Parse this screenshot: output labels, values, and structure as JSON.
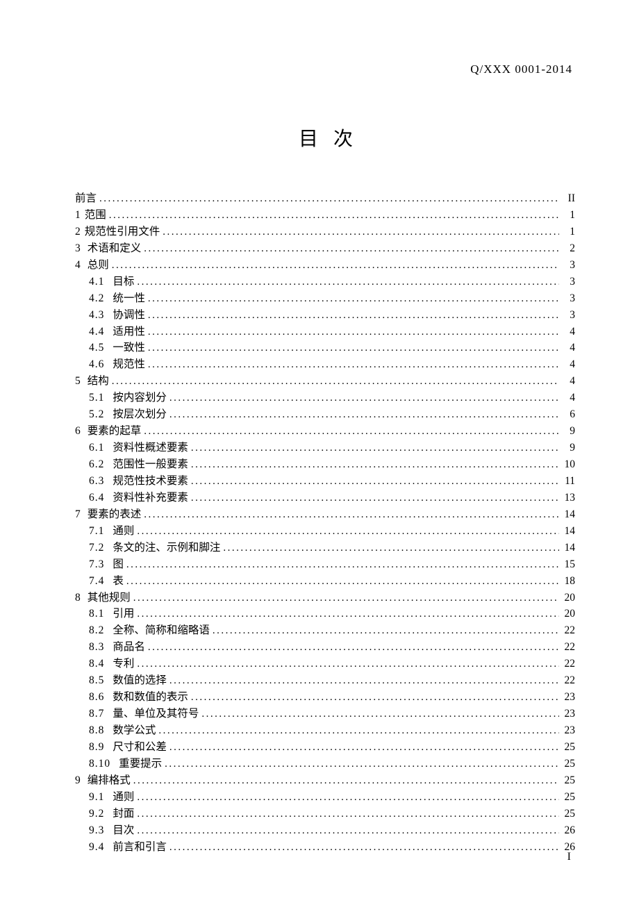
{
  "header": {
    "doc_code": "Q/XXX 0001-2014"
  },
  "title": "目次",
  "toc": [
    {
      "level": 1,
      "num": "",
      "text": "前言",
      "page": "II"
    },
    {
      "level": 1,
      "num": "1",
      "text": "范围",
      "page": "1"
    },
    {
      "level": 1,
      "num": "2",
      "text": "规范性引用文件",
      "page": "1"
    },
    {
      "level": 1,
      "num": "3",
      "text": "术语和定义",
      "page": "2",
      "sec_gap": true
    },
    {
      "level": 1,
      "num": "4",
      "text": "总则",
      "page": "3",
      "sec_gap": true
    },
    {
      "level": 2,
      "num": "4.1",
      "text": "目标",
      "page": "3"
    },
    {
      "level": 2,
      "num": "4.2",
      "text": "统一性",
      "page": "3"
    },
    {
      "level": 2,
      "num": "4.3",
      "text": "协调性",
      "page": "3"
    },
    {
      "level": 2,
      "num": "4.4",
      "text": "适用性",
      "page": "4"
    },
    {
      "level": 2,
      "num": "4.5",
      "text": "一致性",
      "page": "4"
    },
    {
      "level": 2,
      "num": "4.6",
      "text": "规范性",
      "page": "4"
    },
    {
      "level": 1,
      "num": "5",
      "text": "结构",
      "page": "4",
      "sec_gap": true
    },
    {
      "level": 2,
      "num": "5.1",
      "text": "按内容划分",
      "page": "4"
    },
    {
      "level": 2,
      "num": "5.2",
      "text": "按层次划分",
      "page": "6"
    },
    {
      "level": 1,
      "num": "6",
      "text": "要素的起草",
      "page": "9",
      "sec_gap": true
    },
    {
      "level": 2,
      "num": "6.1",
      "text": "资料性概述要素",
      "page": "9"
    },
    {
      "level": 2,
      "num": "6.2",
      "text": "范围性一般要素",
      "page": "10"
    },
    {
      "level": 2,
      "num": "6.3",
      "text": "规范性技术要素",
      "page": "11"
    },
    {
      "level": 2,
      "num": "6.4",
      "text": "资料性补充要素",
      "page": "13"
    },
    {
      "level": 1,
      "num": "7",
      "text": "要素的表述",
      "page": "14",
      "sec_gap": true
    },
    {
      "level": 2,
      "num": "7.1",
      "text": "通则",
      "page": "14"
    },
    {
      "level": 2,
      "num": "7.2",
      "text": "条文的注、示例和脚注",
      "page": "14"
    },
    {
      "level": 2,
      "num": "7.3",
      "text": "图",
      "page": "15"
    },
    {
      "level": 2,
      "num": "7.4",
      "text": "表",
      "page": "18"
    },
    {
      "level": 1,
      "num": "8",
      "text": "其他规则",
      "page": "20",
      "sec_gap": true
    },
    {
      "level": 2,
      "num": "8.1",
      "text": "引用",
      "page": "20"
    },
    {
      "level": 2,
      "num": "8.2",
      "text": "全称、简称和缩略语",
      "page": "22"
    },
    {
      "level": 2,
      "num": "8.3",
      "text": "商品名",
      "page": "22"
    },
    {
      "level": 2,
      "num": "8.4",
      "text": "专利",
      "page": "22"
    },
    {
      "level": 2,
      "num": "8.5",
      "text": "数值的选择",
      "page": "22"
    },
    {
      "level": 2,
      "num": "8.6",
      "text": "数和数值的表示",
      "page": "23"
    },
    {
      "level": 2,
      "num": "8.7",
      "text": "量、单位及其符号",
      "page": "23"
    },
    {
      "level": 2,
      "num": "8.8",
      "text": "数学公式",
      "page": "23"
    },
    {
      "level": 2,
      "num": "8.9",
      "text": "尺寸和公差",
      "page": "25"
    },
    {
      "level": 2,
      "num": "8.10",
      "text": "重要提示",
      "page": "25"
    },
    {
      "level": 1,
      "num": "9",
      "text": "编排格式",
      "page": "25",
      "sec_gap": true
    },
    {
      "level": 2,
      "num": "9.1",
      "text": "通则",
      "page": "25"
    },
    {
      "level": 2,
      "num": "9.2",
      "text": "封面",
      "page": "25"
    },
    {
      "level": 2,
      "num": "9.3",
      "text": "目次",
      "page": "26"
    },
    {
      "level": 2,
      "num": "9.4",
      "text": "前言和引言",
      "page": "26"
    }
  ],
  "footer": {
    "page_number": "I"
  }
}
